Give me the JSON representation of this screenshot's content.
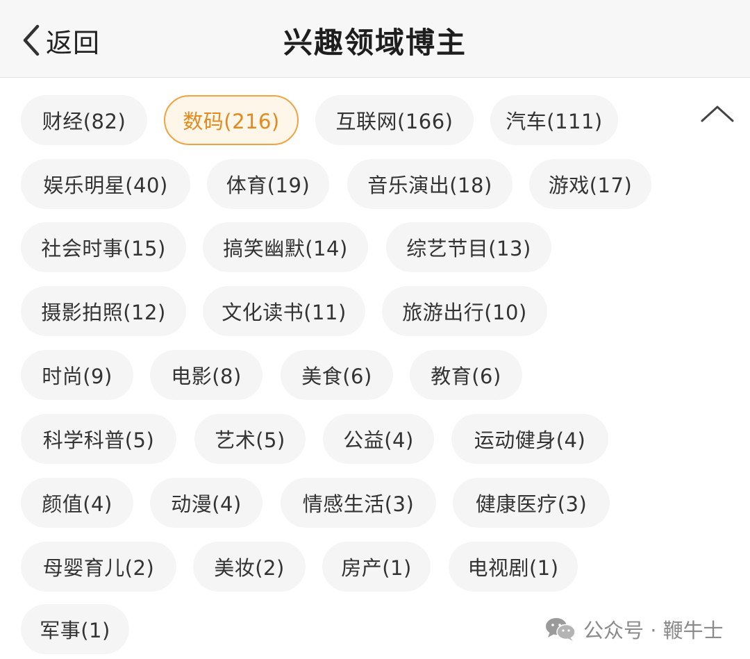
{
  "nav": {
    "back_label": "返回",
    "title": "兴趣领域博主"
  },
  "tags": [
    {
      "label": "财经(82)",
      "selected": false
    },
    {
      "label": "数码(216)",
      "selected": true
    },
    {
      "label": "互联网(166)",
      "selected": false
    },
    {
      "label": "汽车(111)",
      "selected": false
    },
    {
      "label": "娱乐明星(40)",
      "selected": false
    },
    {
      "label": "体育(19)",
      "selected": false
    },
    {
      "label": "音乐演出(18)",
      "selected": false
    },
    {
      "label": "游戏(17)",
      "selected": false
    },
    {
      "label": "社会时事(15)",
      "selected": false
    },
    {
      "label": "搞笑幽默(14)",
      "selected": false
    },
    {
      "label": "综艺节目(13)",
      "selected": false
    },
    {
      "label": "摄影拍照(12)",
      "selected": false
    },
    {
      "label": "文化读书(11)",
      "selected": false
    },
    {
      "label": "旅游出行(10)",
      "selected": false
    },
    {
      "label": "时尚(9)",
      "selected": false
    },
    {
      "label": "电影(8)",
      "selected": false
    },
    {
      "label": "美食(6)",
      "selected": false
    },
    {
      "label": "教育(6)",
      "selected": false
    },
    {
      "label": "科学科普(5)",
      "selected": false
    },
    {
      "label": "艺术(5)",
      "selected": false
    },
    {
      "label": "公益(4)",
      "selected": false
    },
    {
      "label": "运动健身(4)",
      "selected": false
    },
    {
      "label": "颜值(4)",
      "selected": false
    },
    {
      "label": "动漫(4)",
      "selected": false
    },
    {
      "label": "情感生活(3)",
      "selected": false
    },
    {
      "label": "健康医疗(3)",
      "selected": false
    },
    {
      "label": "母婴育儿(2)",
      "selected": false
    },
    {
      "label": "美妆(2)",
      "selected": false
    },
    {
      "label": "房产(1)",
      "selected": false
    },
    {
      "label": "电视剧(1)",
      "selected": false
    },
    {
      "label": "军事(1)",
      "selected": false
    }
  ],
  "collapse_icon": "chevron-up-icon",
  "watermark": {
    "text": "公众号 · 鞭牛士",
    "icon": "wechat-icon"
  },
  "colors": {
    "accent": "#e38a1d",
    "accent_border": "#f0a340",
    "chip_bg": "#f5f5f5",
    "nav_bg": "#f7f7f7"
  }
}
